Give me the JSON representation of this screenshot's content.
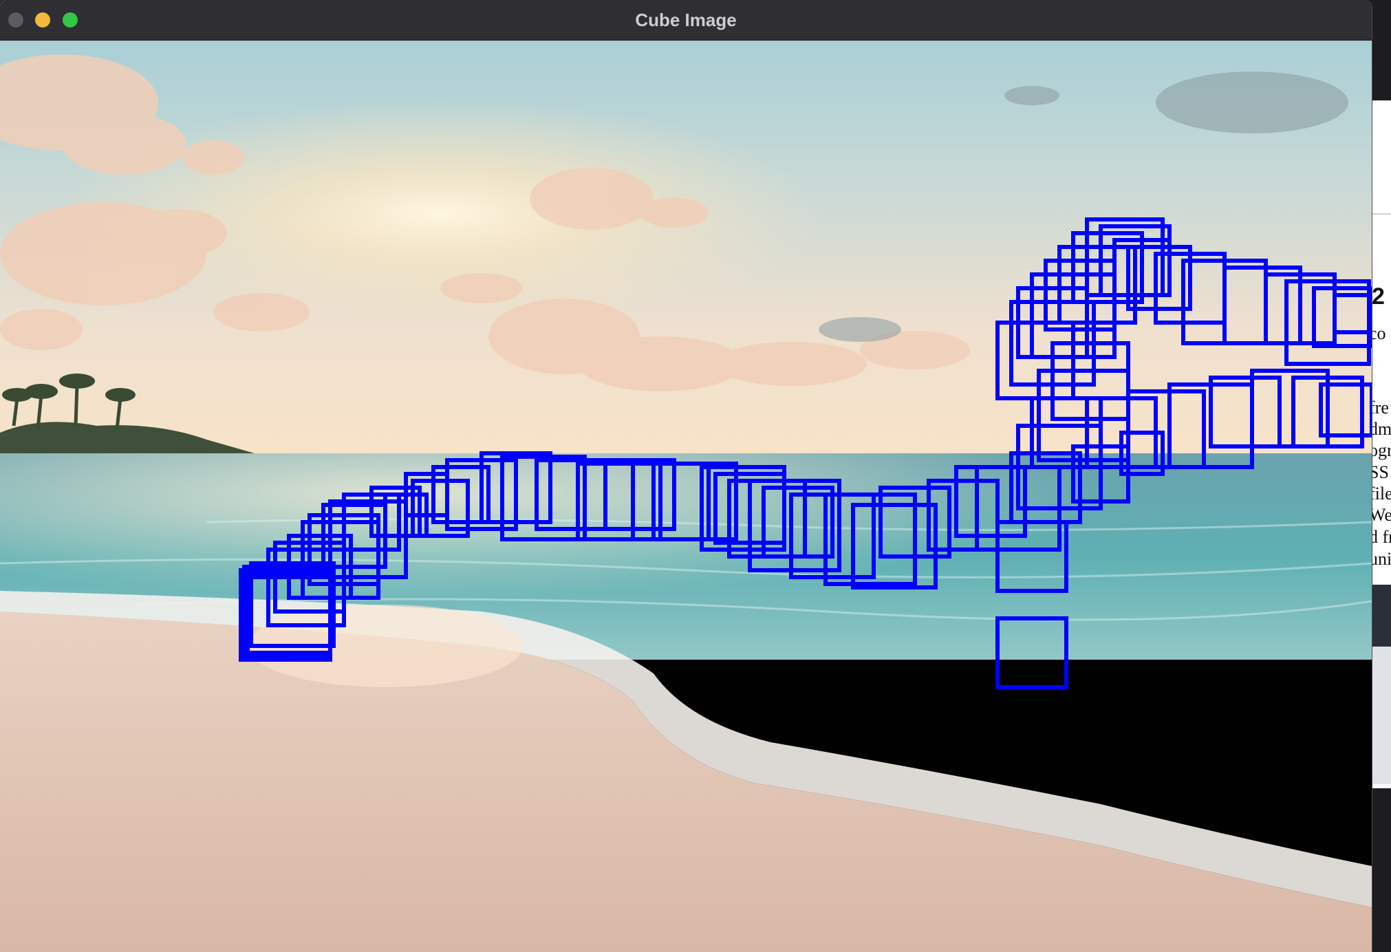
{
  "window": {
    "title": "Cube Image",
    "controls": [
      "close",
      "minimize",
      "zoom"
    ]
  },
  "background_window": {
    "heading_fragment": "2",
    "text_fragments": [
      "co",
      "fre",
      "dma",
      "ogr",
      "SS",
      "file",
      "Web",
      "d fr",
      "uni"
    ]
  },
  "image": {
    "description_icon": "beach-sunset-photo",
    "overlay_color": "#0000ff"
  }
}
